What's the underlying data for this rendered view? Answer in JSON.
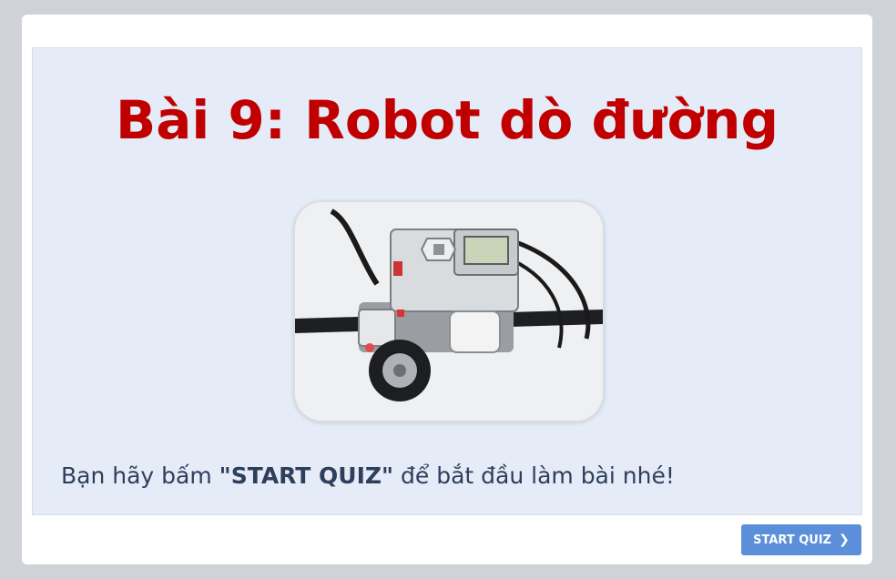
{
  "slide": {
    "title": "Bài 9: Robot dò đường",
    "image_alt": "LEGO EV3 line-following robot",
    "prompt_before": "Bạn hãy bấm ",
    "prompt_bold": "\"START QUIZ\"",
    "prompt_after": " để bắt đầu làm bài nhé!"
  },
  "footer": {
    "start_label": "START QUIZ",
    "start_icon": "chevron-right-icon"
  },
  "colors": {
    "title": "#c00000",
    "slide_bg": "#e5ebf7",
    "button": "#5b8fd9",
    "text": "#2e3f5c"
  }
}
